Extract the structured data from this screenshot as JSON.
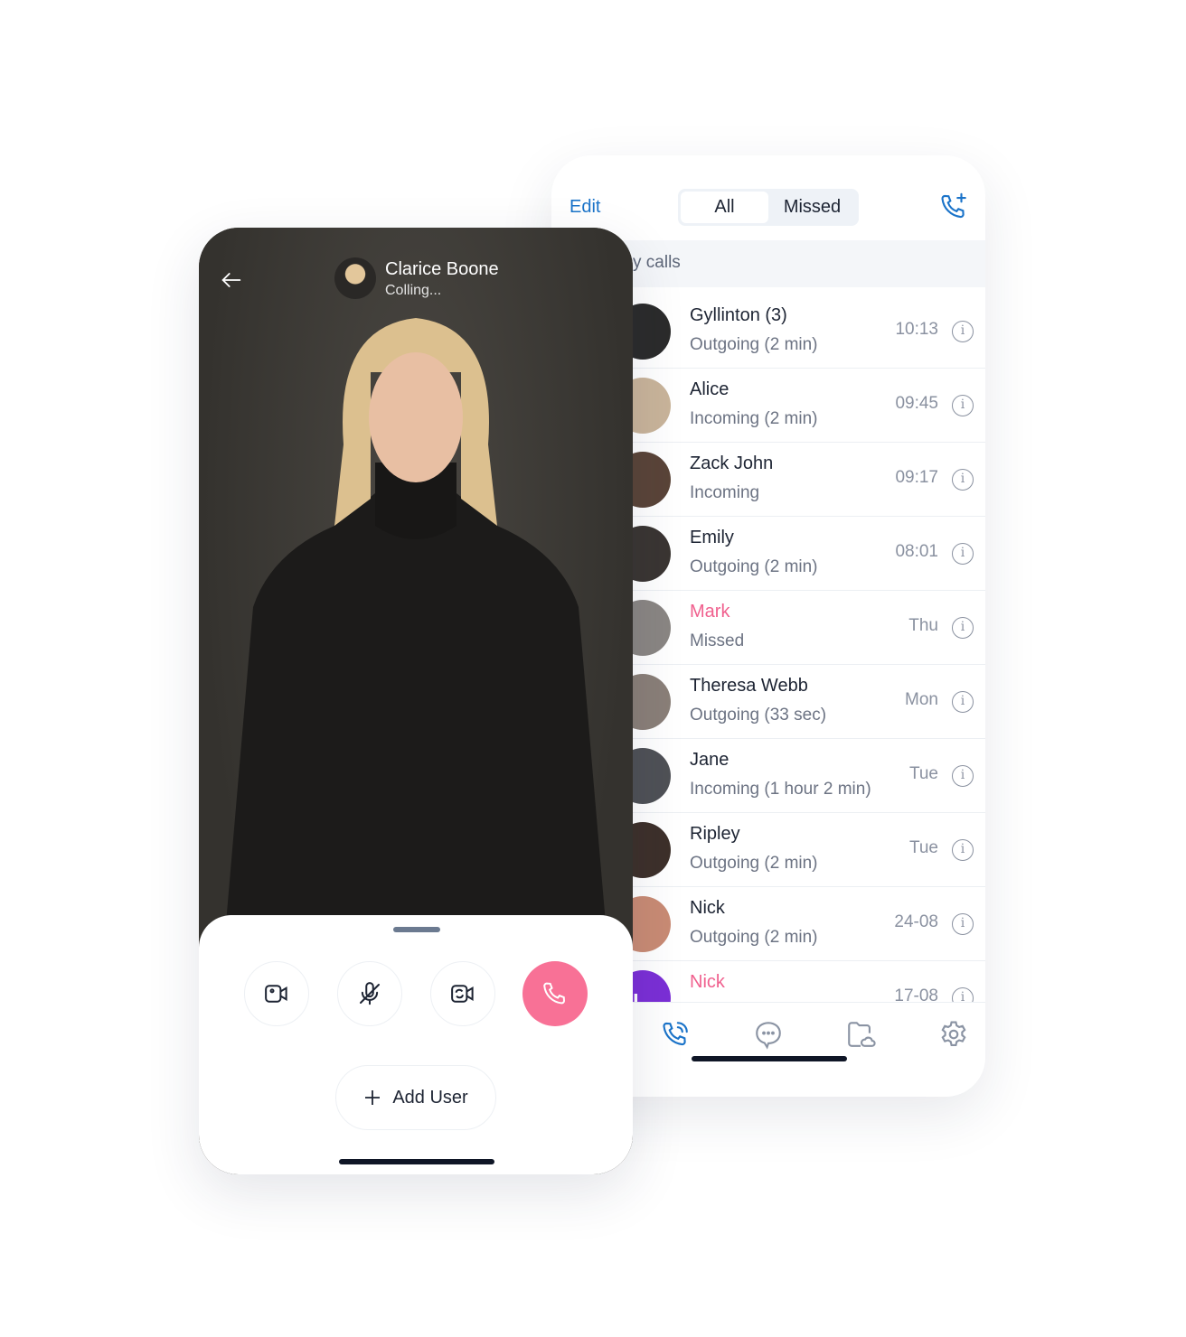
{
  "call_log": {
    "edit_label": "Edit",
    "tabs": [
      {
        "label": "All",
        "active": true
      },
      {
        "label": "Missed",
        "active": false
      }
    ],
    "section_title": "y calls",
    "rows": [
      {
        "name": "Gyllinton (3)",
        "detail": "Outgoing (2 min)",
        "time": "10:13",
        "missed": false,
        "avatar": "#2b2b2b"
      },
      {
        "name": "Alice",
        "detail": "Incoming (2 min)",
        "time": "09:45",
        "missed": false,
        "avatar": "#c9b49a"
      },
      {
        "name": "Zack John",
        "detail": "Incoming",
        "time": "09:17",
        "missed": false,
        "avatar": "#5a4438"
      },
      {
        "name": "Emily",
        "detail": "Outgoing (2 min)",
        "time": "08:01",
        "missed": false,
        "avatar": "#3a3532"
      },
      {
        "name": "Mark",
        "detail": "Missed",
        "time": "Thu",
        "missed": true,
        "avatar": "#8a8683"
      },
      {
        "name": "Theresa Webb",
        "detail": "Outgoing (33 sec)",
        "time": "Mon",
        "missed": false,
        "avatar": "#8a7f78"
      },
      {
        "name": "Jane",
        "detail": "Incoming (1 hour 2 min)",
        "time": "Tue",
        "missed": false,
        "avatar": "#4f5156"
      },
      {
        "name": "Ripley",
        "detail": "Outgoing (2 min)",
        "time": "Tue",
        "missed": false,
        "avatar": "#3d302a"
      },
      {
        "name": "Nick",
        "detail": "Outgoing (2 min)",
        "time": "24-08",
        "missed": false,
        "avatar": "#c98b74"
      },
      {
        "name": "Nick",
        "detail": "",
        "time": "17-08",
        "missed": true,
        "avatar": "#7b2fd6",
        "initial": "N"
      }
    ],
    "tabbar": [
      "phone-icon",
      "chat-icon",
      "folder-cloud-icon",
      "settings-icon"
    ],
    "accent": "#1a73c9",
    "missed_color": "#f0608e"
  },
  "call_screen": {
    "contact_name": "Clarice Boone",
    "status": "Colling...",
    "add_user_label": "Add User",
    "end_color": "#f87196"
  }
}
